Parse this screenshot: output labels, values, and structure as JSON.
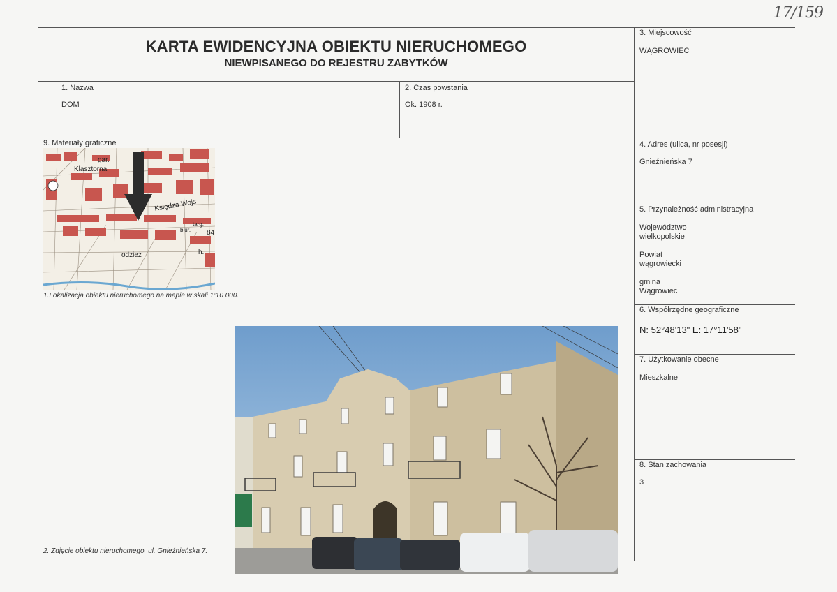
{
  "archive_number": "17/159",
  "header": {
    "title": "KARTA EWIDENCYJNA OBIEKTU NIERUCHOMEGO",
    "subtitle": "NIEWPISANEGO DO REJESTRU ZABYTKÓW"
  },
  "fields": {
    "name": {
      "label": "1.   Nazwa",
      "value": "DOM"
    },
    "time": {
      "label": "2. Czas powstania",
      "value": "Ok. 1908 r."
    },
    "locality": {
      "label": "3. Miejscowość",
      "value": "WĄGROWIEC"
    },
    "address": {
      "label": "4. Adres (ulica, nr posesji)",
      "value": "Gnieźnieńska 7"
    },
    "admin": {
      "label": "5. Przynależność administracyjna",
      "voivodeship_label": "Województwo",
      "voivodeship": "wielkopolskie",
      "county_label": "Powiat",
      "county": "wągrowiecki",
      "commune_label": "gmina",
      "commune": "Wągrowiec"
    },
    "coords": {
      "label": "6. Współrzędne geograficzne",
      "value": "N: 52°48'13\"  E: 17°11'58\""
    },
    "usage": {
      "label": "7. Użytkowanie obecne",
      "value": "Mieszkalne"
    },
    "condition": {
      "label": "8. Stan zachowania",
      "value": "3"
    },
    "graphics": {
      "label": "9. Materiały graficzne"
    }
  },
  "map": {
    "caption": "1.Lokalizacja obiektu nieruchomego na mapie w skali 1:10 000.",
    "labels": [
      "gar.",
      "Klasztorna",
      "Księdza Wojs",
      "targ.",
      "biur.",
      "84",
      "odzież",
      "h."
    ]
  },
  "photo": {
    "caption": "2. Zdjęcie obiektu nieruchomego. ul. Gnieźnieńska 7."
  },
  "colors": {
    "map_block": "#c8564f",
    "map_bg": "#f3efe6",
    "sky": "#7ea6cc",
    "facade": "#d2c7ae"
  }
}
